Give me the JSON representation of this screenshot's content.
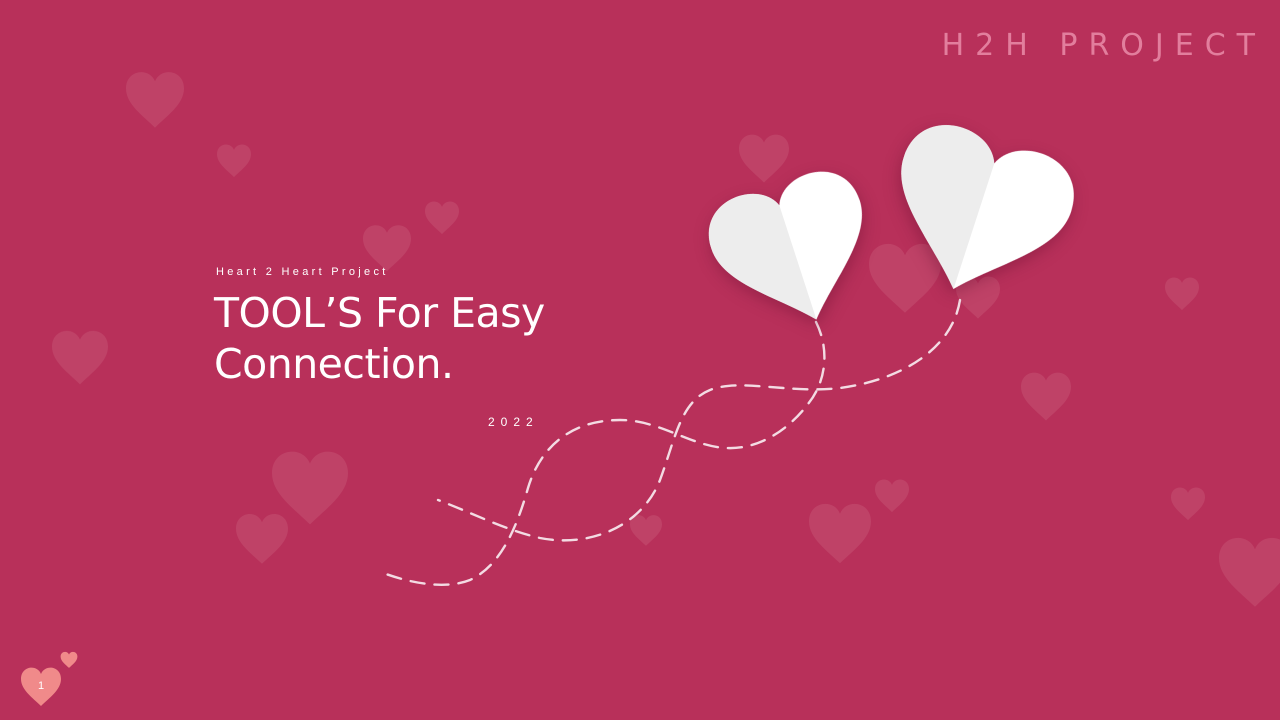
{
  "slide": {
    "brand": "H2H PROJECT",
    "kicker": "Heart 2 Heart Project",
    "title": "TOOL’S For  Easy\nConnection.",
    "year": "2022",
    "page_number": "1"
  },
  "colors": {
    "background": "#b8305a",
    "background_heart": "#c24b6e",
    "brand_text": "#e27e9d",
    "accent_heart": "#f08a8a",
    "paper_heart": "#ffffff",
    "dashed_string": "#f3dbe3"
  },
  "icons": {
    "paper_hearts": "heart-balloon-icon",
    "page_badge": "heart-icon"
  }
}
